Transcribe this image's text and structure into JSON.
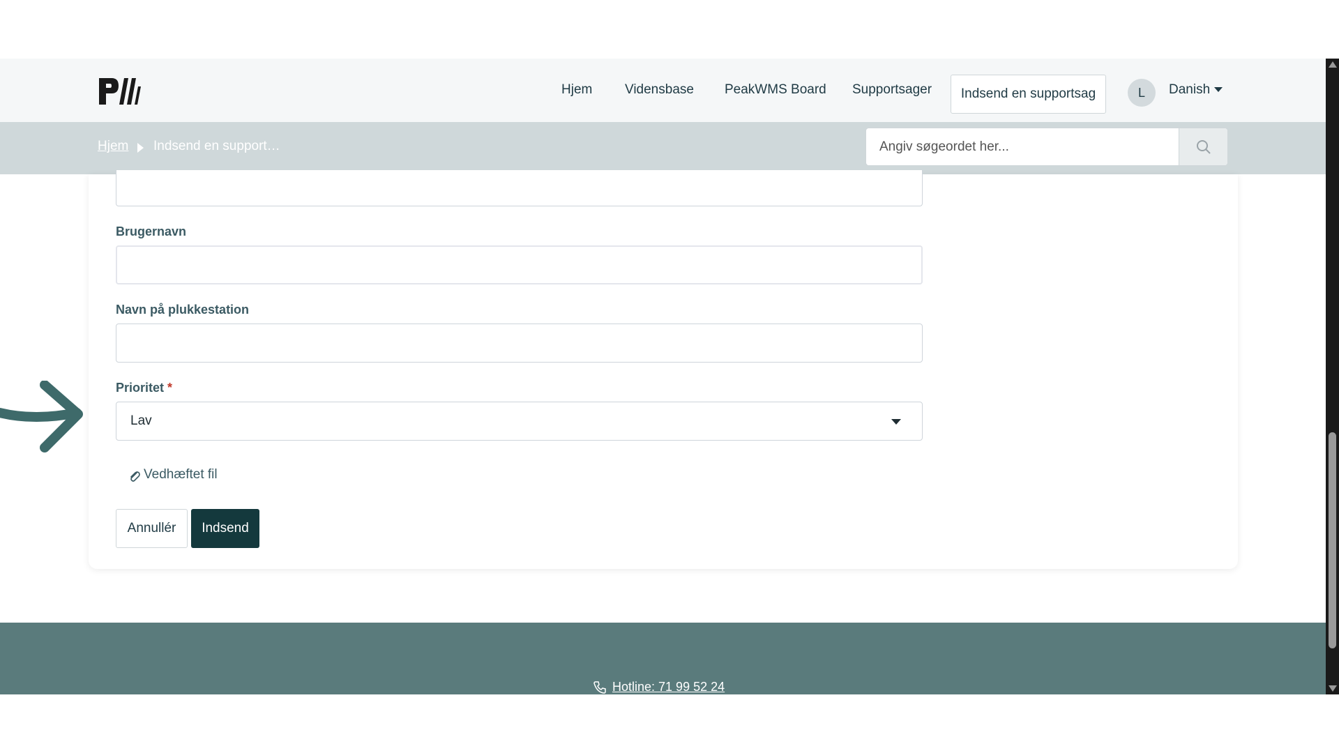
{
  "header": {
    "logo_text": "PW",
    "nav": {
      "home": "Hjem",
      "knowledge": "Vidensbase",
      "board": "PeakWMS Board",
      "cases": "Supportsager",
      "submit": "Indsend en supportsag"
    },
    "avatar_initial": "L",
    "language": "Danish"
  },
  "breadcrumb": {
    "home": "Hjem",
    "current": "Indsend en support…"
  },
  "search": {
    "placeholder": "Angiv søgeordet her..."
  },
  "form": {
    "username_label": "Brugernavn",
    "username_value": "",
    "station_label": "Navn på plukkestation",
    "station_value": "",
    "priority_label": "Prioritet",
    "priority_required": "*",
    "priority_value": "Lav",
    "attach_label": "Vedhæftet fil",
    "cancel_label": "Annullér",
    "submit_label": "Indsend"
  },
  "footer": {
    "hotline": "Hotline: 71 99 52 24"
  },
  "colors": {
    "primary": "#14393d",
    "footer": "#5a7b7c",
    "crumbbar": "#cfd8da",
    "arrow": "#3e6a6a"
  },
  "icons": {
    "search": "search-icon",
    "attach": "paperclip-icon",
    "phone": "phone-icon",
    "arrow": "arrow-right-icon"
  }
}
